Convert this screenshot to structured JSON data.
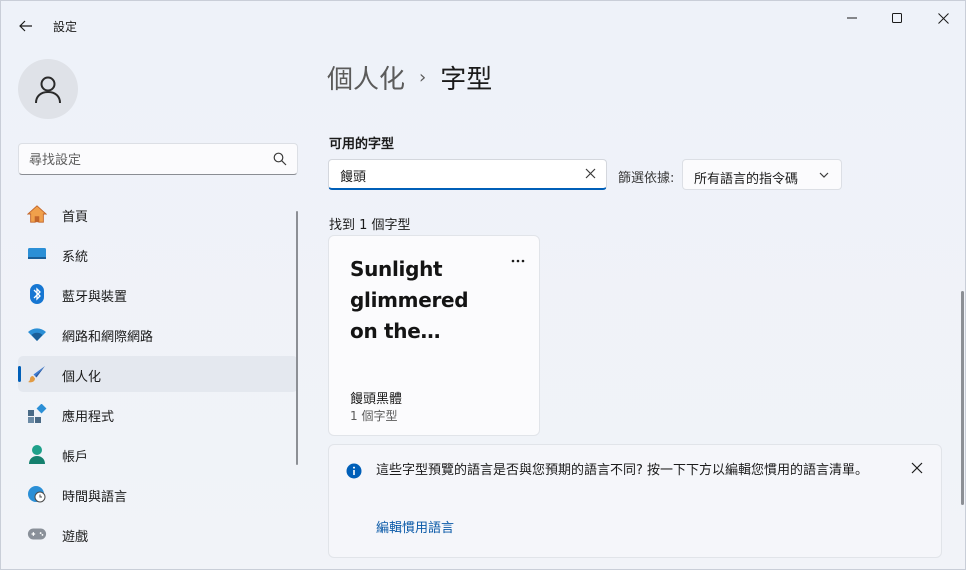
{
  "window": {
    "app_title": "設定",
    "controls": [
      "minimize-icon",
      "maximize-icon",
      "close-icon"
    ]
  },
  "sidebar": {
    "search_placeholder": "尋找設定",
    "items": [
      {
        "label": "首頁",
        "icon": "home-icon",
        "active": false
      },
      {
        "label": "系統",
        "icon": "system-monitor-icon",
        "active": false
      },
      {
        "label": "藍牙與裝置",
        "icon": "bluetooth-icon",
        "active": false
      },
      {
        "label": "網路和網際網路",
        "icon": "wifi-icon",
        "active": false
      },
      {
        "label": "個人化",
        "icon": "paintbrush-icon",
        "active": true
      },
      {
        "label": "應用程式",
        "icon": "apps-icon",
        "active": false
      },
      {
        "label": "帳戶",
        "icon": "account-icon",
        "active": false
      },
      {
        "label": "時間與語言",
        "icon": "globe-clock-icon",
        "active": false
      },
      {
        "label": "遊戲",
        "icon": "gamepad-icon",
        "active": false
      }
    ]
  },
  "main": {
    "breadcrumb": {
      "parent": "個人化",
      "separator": "›",
      "current": "字型"
    },
    "section_title": "可用的字型",
    "font_search_value": "饅頭",
    "filter_label": "篩選依據:",
    "filter_value": "所有語言的指令碼",
    "found_label": "找到 1 個字型",
    "font_card": {
      "preview_lines": [
        "Sunlight",
        "glimmered",
        "on the…"
      ],
      "more_label": "···",
      "name": "饅頭黑體",
      "count": "1 個字型"
    },
    "info_bar": {
      "message": "這些字型預覽的語言是否與您預期的語言不同? 按一下下方以編輯您慣用的語言清單。",
      "link": "編輯慣用語言"
    }
  },
  "colors": {
    "accent": "#005fb8",
    "link": "#0a5aa8",
    "background": "#eef2f8"
  }
}
